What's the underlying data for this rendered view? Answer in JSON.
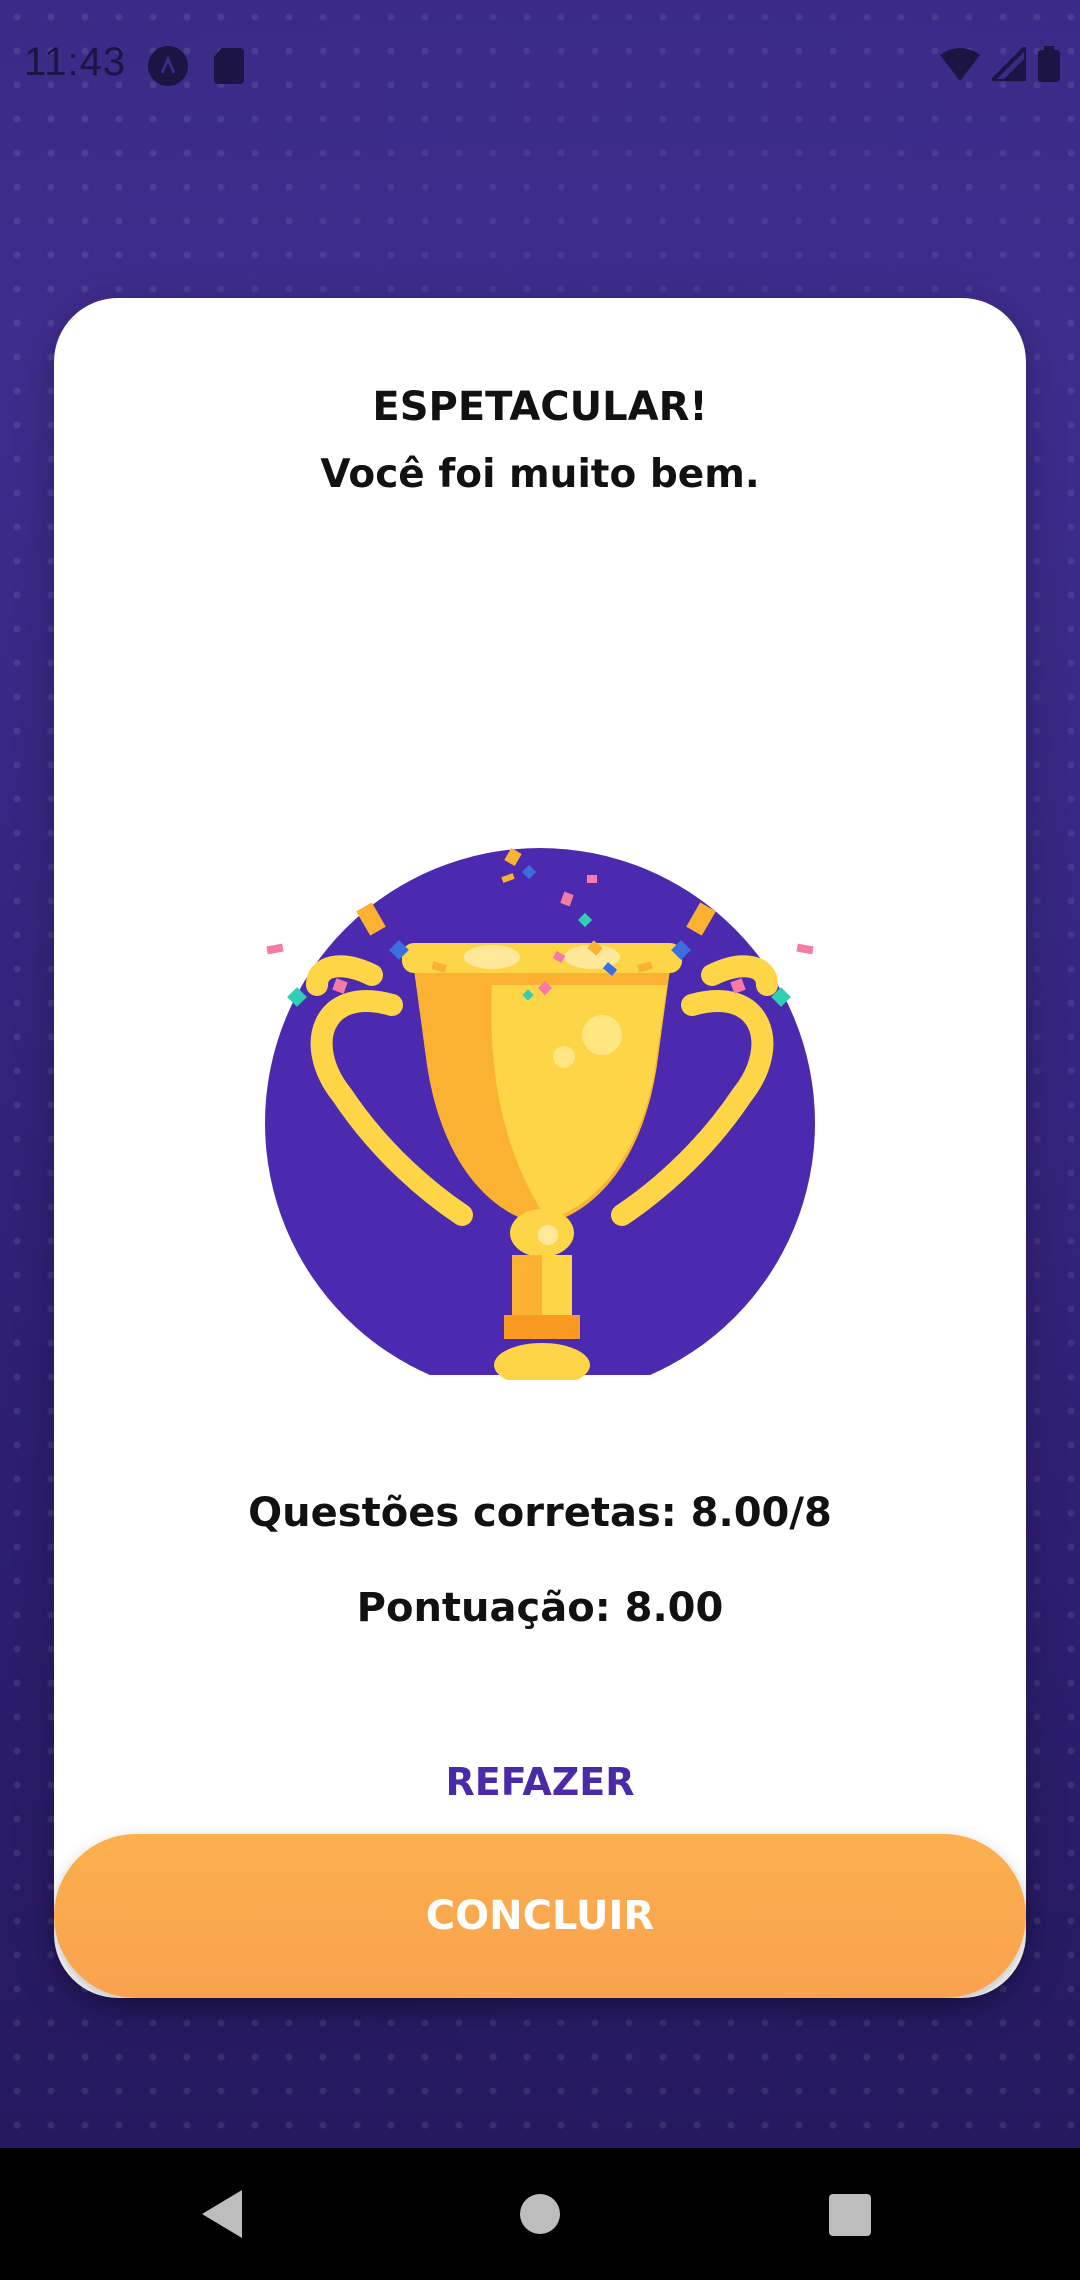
{
  "status_bar": {
    "time": "11:43"
  },
  "result": {
    "title": "ESPETACULAR!",
    "subtitle": "Você foi muito bem."
  },
  "stats": {
    "correct_questions": "Questões corretas: 8.00/8",
    "score": "Pontuação: 8.00"
  },
  "actions": {
    "redo_label": "REFAZER",
    "finish_label": "CONCLUIR"
  },
  "icons": {
    "trophy": "trophy-icon",
    "wifi": "wifi-icon",
    "signal": "signal-icon",
    "battery": "battery-icon",
    "back": "back-icon",
    "home": "home-icon",
    "recents": "recents-icon"
  },
  "colors": {
    "accent_purple": "#4b2aa8",
    "button_orange": "#fbb04c",
    "trophy_circle": "#4b2ab0"
  }
}
